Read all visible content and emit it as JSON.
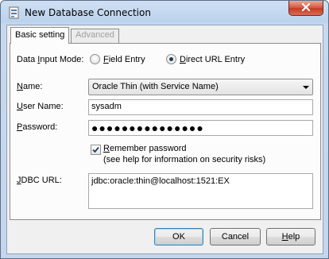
{
  "window": {
    "title": "New Database Connection"
  },
  "tabs": [
    {
      "label": "Basic setting",
      "active": true
    },
    {
      "label": "Advanced",
      "active": false
    }
  ],
  "form": {
    "data_input_mode": {
      "label_pre": "Data ",
      "label_u": "I",
      "label_post": "nput Mode:",
      "options": [
        {
          "pre": "",
          "u": "F",
          "post": "ield Entry",
          "selected": false
        },
        {
          "pre": "",
          "u": "D",
          "post": "irect URL Entry",
          "selected": true
        }
      ]
    },
    "name": {
      "label_u": "N",
      "label_post": "ame:",
      "value": "Oracle Thin (with Service Name)"
    },
    "user_name": {
      "label_u": "U",
      "label_post": "ser Name:",
      "value": "sysadm"
    },
    "password": {
      "label_u": "P",
      "label_post": "assword:",
      "value": "●●●●●●●●●●●●●●●"
    },
    "remember": {
      "label_u": "R",
      "label_post": "emember password",
      "hint": "(see help for information on security risks)",
      "checked": true
    },
    "jdbc_url": {
      "label_u": "J",
      "label_post": "DBC URL:",
      "value": "jdbc:oracle:thin@localhost:1521:EX"
    }
  },
  "buttons": {
    "ok": {
      "label": "OK"
    },
    "cancel": {
      "label": "Cancel"
    },
    "help": {
      "pre": "",
      "u": "H",
      "post": "elp"
    }
  },
  "icons": {
    "app": "database-icon",
    "close": "close-icon",
    "dropdown": "chevron-down-icon",
    "check": "checkmark-icon"
  }
}
